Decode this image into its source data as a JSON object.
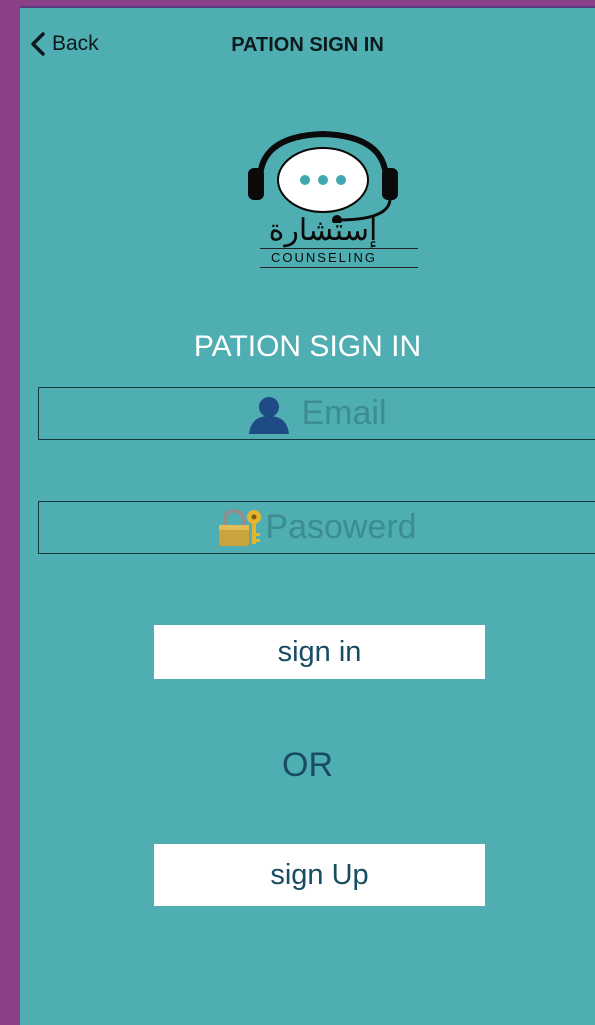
{
  "navbar": {
    "back_label": "Back",
    "title": "PATION SIGN IN"
  },
  "logo": {
    "arabic_text": "إستشارة",
    "english_text": "COUNSELING"
  },
  "section_title": "PATION SIGN IN",
  "email_field": {
    "placeholder": "Email",
    "icon": "user-icon"
  },
  "password_field": {
    "placeholder": "Pasowerd",
    "icon": "lock-key-icon"
  },
  "sign_in_button": "sign in",
  "or_label": "OR",
  "sign_up_button": "sign Up",
  "colors": {
    "background": "#4faeb1",
    "outer_frame": "#8a3f87",
    "title_text": "#ffffff",
    "button_text": "#174c62",
    "placeholder_text": "#3c8d8f"
  }
}
